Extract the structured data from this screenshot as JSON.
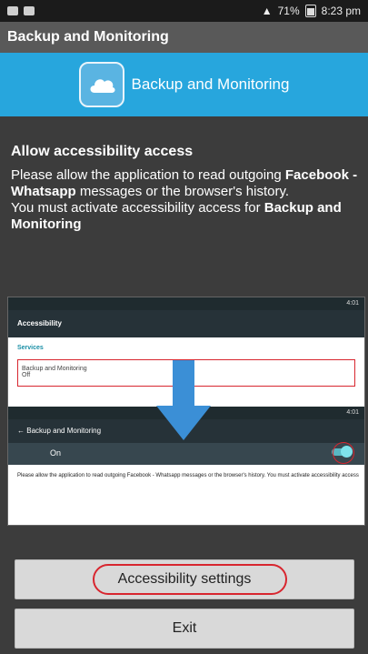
{
  "status_bar": {
    "left_icons": [
      "image-icon",
      "message-icon"
    ],
    "battery": "71%",
    "time": "8:23 pm"
  },
  "app_bar": {
    "title": "Backup and Monitoring"
  },
  "banner": {
    "icon": "cloud-icon",
    "title": "Backup and Monitoring"
  },
  "main": {
    "heading": "Allow accessibility access",
    "line1": "Please allow the application to read outgoing",
    "apps_bold": "Facebook - Whatsapp",
    "line2": " messages or the browser's history.",
    "line3": " You must activate accessibility access for ",
    "app_bold": "Backup and Monitoring"
  },
  "screenshot": {
    "status_time_1": "4:01",
    "header_1": "Accessibility",
    "section": "Services",
    "service_name": "Backup and Monitoring",
    "service_state": "Off",
    "status_time_2": "4:01",
    "header_2": "Backup and Monitoring",
    "toggle_label": "On",
    "description": "Please allow the application to read outgoing Facebook - Whatsapp messages or the browser's history. You must activate accessibility access"
  },
  "buttons": {
    "accessibility": "Accessibility settings",
    "exit": "Exit"
  },
  "colors": {
    "banner": "#27a6dd",
    "highlight": "#d8262f",
    "arrow": "#3b8fd6"
  }
}
